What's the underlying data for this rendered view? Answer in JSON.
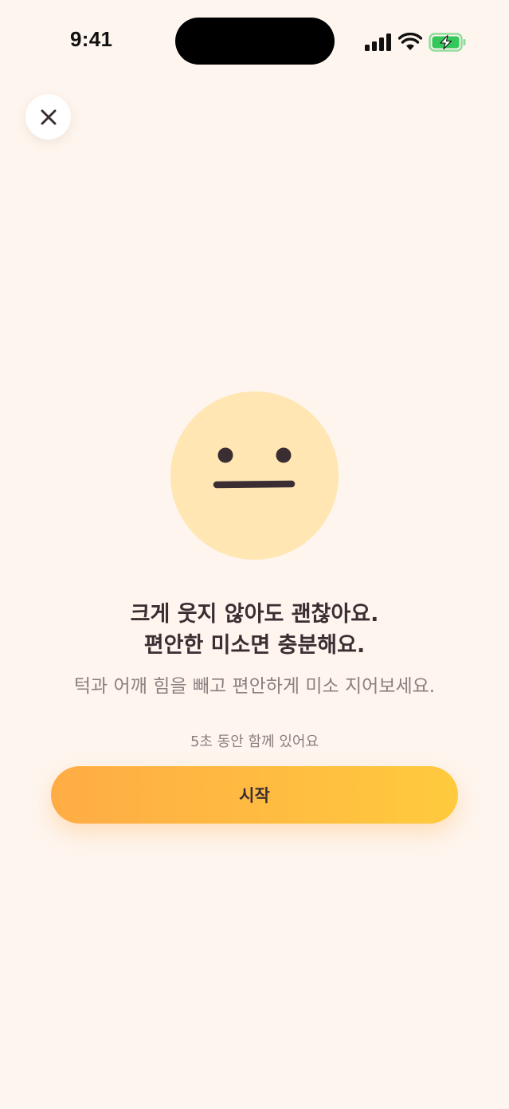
{
  "status_bar": {
    "time": "9:41",
    "icons": [
      "cellular-signal-icon",
      "wifi-icon",
      "battery-charging-icon"
    ],
    "battery_color": "#34C759"
  },
  "header": {
    "close_icon": "close-icon"
  },
  "face": {
    "icon": "neutral-face-icon",
    "fill_color": "#FFE6B3",
    "feature_color": "#3A2E33"
  },
  "content": {
    "headline_line1": "크게 웃지 않아도 괜찮아요.",
    "headline_line2": "편안한 미소면 충분해요.",
    "subtitle": "턱과 어깨 힘을 빼고 편안하게 미소 지어보세요.",
    "duration_text": "5초 동안 함께 있어요"
  },
  "actions": {
    "start_label": "시작",
    "gradient_start": "#FFAC45",
    "gradient_end": "#FFCA3D"
  },
  "colors": {
    "background": "#FEF5EE",
    "text_primary": "#3A2E33",
    "text_secondary": "#8B7F80"
  }
}
